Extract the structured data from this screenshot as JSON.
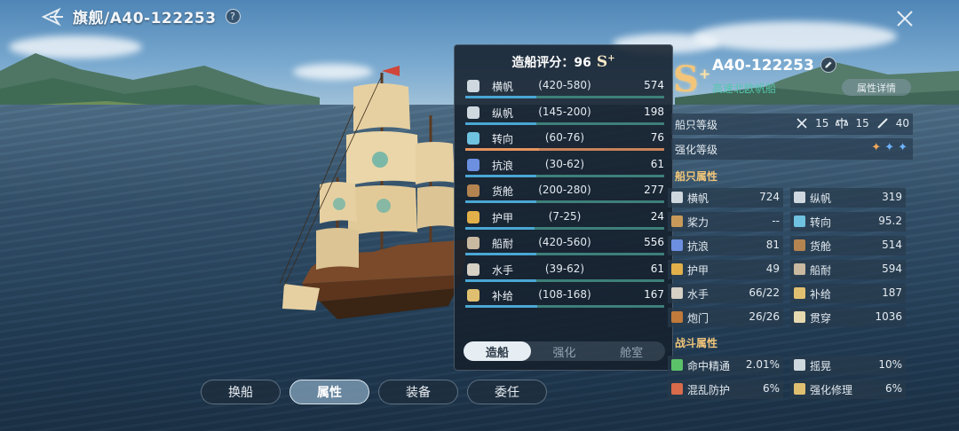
{
  "header": {
    "title": "旗舰/A40-122253",
    "help": "?"
  },
  "panel": {
    "title": "造船评分：96",
    "grade": "S",
    "grade_suffix": "+",
    "stats": [
      {
        "name": "横帆",
        "range": "(420-580)",
        "value": "574",
        "fill": 0.96,
        "icon": "square-sail-icon",
        "color": "#cfd8df"
      },
      {
        "name": "纵帆",
        "range": "(145-200)",
        "value": "198",
        "fill": 0.96,
        "icon": "fore-aft-sail-icon",
        "color": "#cfd8df"
      },
      {
        "name": "转向",
        "range": "(60-76)",
        "value": "76",
        "fill": 1.0,
        "icon": "turning-icon",
        "color": "#6fc3e0",
        "highlight": true
      },
      {
        "name": "抗浪",
        "range": "(30-62)",
        "value": "61",
        "fill": 0.97,
        "icon": "wave-icon",
        "color": "#6c8fe0"
      },
      {
        "name": "货舱",
        "range": "(200-280)",
        "value": "277",
        "fill": 0.96,
        "icon": "cargo-icon",
        "color": "#b48450"
      },
      {
        "name": "护甲",
        "range": "(7-25)",
        "value": "24",
        "fill": 0.94,
        "icon": "armor-icon",
        "color": "#e2b04a"
      },
      {
        "name": "船耐",
        "range": "(420-560)",
        "value": "556",
        "fill": 0.97,
        "icon": "durability-icon",
        "color": "#c9b9a0"
      },
      {
        "name": "水手",
        "range": "(39-62)",
        "value": "61",
        "fill": 0.96,
        "icon": "sailor-icon",
        "color": "#d6d0c5"
      },
      {
        "name": "补给",
        "range": "(108-168)",
        "value": "167",
        "fill": 0.98,
        "icon": "supply-icon",
        "color": "#e0c070"
      }
    ],
    "tabs": [
      {
        "label": "造船",
        "active": true
      },
      {
        "label": "强化",
        "active": false
      },
      {
        "label": "舱室",
        "active": false
      }
    ]
  },
  "nav": [
    {
      "label": "换船",
      "active": false
    },
    {
      "label": "属性",
      "active": true
    },
    {
      "label": "装备",
      "active": false
    },
    {
      "label": "委任",
      "active": false
    }
  ],
  "right": {
    "grade": "S",
    "grade_suffix": "+",
    "code": "A40-122253",
    "type": "高速北欧帆船",
    "detail_button": "属性详情",
    "ship_level_label": "船只等级",
    "levels": [
      "15",
      "15",
      "40"
    ],
    "enhance_label": "强化等级",
    "stars": [
      "✦",
      "✦",
      "✦"
    ],
    "ship_attr_title": "船只属性",
    "attrs": [
      {
        "name": "横帆",
        "value": "724",
        "color": "#cfd8df"
      },
      {
        "name": "纵帆",
        "value": "319",
        "color": "#cfd8df"
      },
      {
        "name": "桨力",
        "value": "--",
        "color": "#c89a5a"
      },
      {
        "name": "转向",
        "value": "95.2",
        "color": "#6fc3e0"
      },
      {
        "name": "抗浪",
        "value": "81",
        "color": "#6c8fe0"
      },
      {
        "name": "货舱",
        "value": "514",
        "color": "#b48450"
      },
      {
        "name": "护甲",
        "value": "49",
        "color": "#e2b04a"
      },
      {
        "name": "船耐",
        "value": "594",
        "color": "#c9b9a0"
      },
      {
        "name": "水手",
        "value": "66/22",
        "color": "#d6d0c5"
      },
      {
        "name": "补给",
        "value": "187",
        "color": "#e0c070"
      },
      {
        "name": "炮门",
        "value": "26/26",
        "color": "#c07a3a"
      },
      {
        "name": "贯穿",
        "value": "1036",
        "color": "#e6d9b0"
      }
    ],
    "battle_attr_title": "战斗属性",
    "battle": [
      {
        "name": "命中精通",
        "value": "2.01%",
        "color": "#5cc26a"
      },
      {
        "name": "摇晃",
        "value": "10%",
        "color": "#cfd8df"
      },
      {
        "name": "混乱防护",
        "value": "6%",
        "color": "#d96b4a"
      },
      {
        "name": "强化修理",
        "value": "6%",
        "color": "#e0c070"
      }
    ]
  }
}
